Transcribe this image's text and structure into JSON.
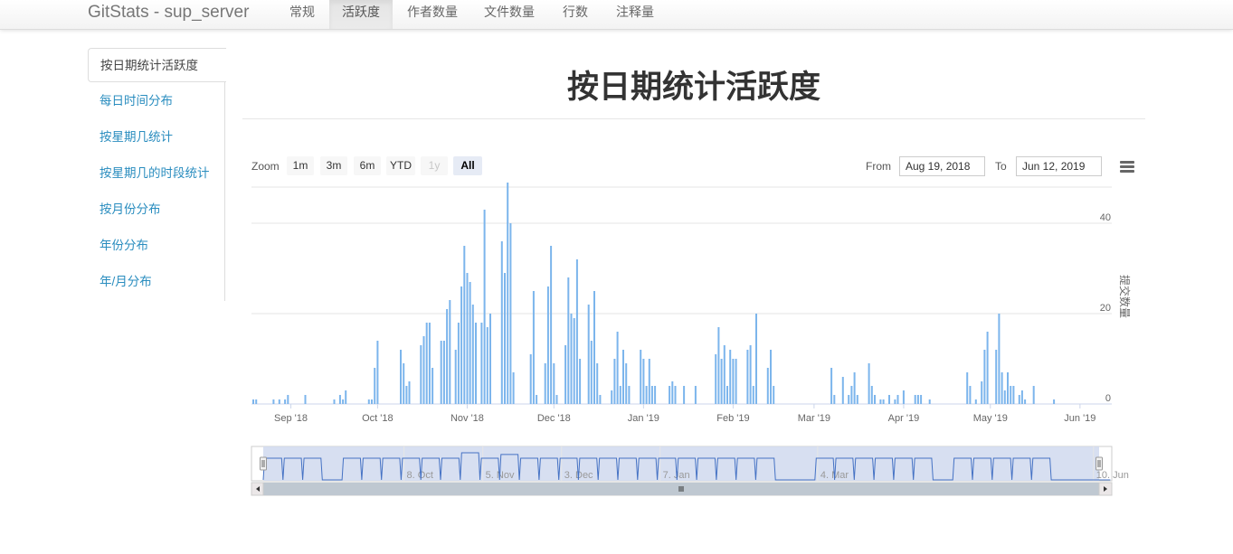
{
  "navbar": {
    "brand": "GitStats - sup_server",
    "items": [
      {
        "label": "常规",
        "active": false
      },
      {
        "label": "活跃度",
        "active": true
      },
      {
        "label": "作者数量",
        "active": false
      },
      {
        "label": "文件数量",
        "active": false
      },
      {
        "label": "行数",
        "active": false
      },
      {
        "label": "注释量",
        "active": false
      }
    ]
  },
  "sidebar": {
    "items": [
      {
        "label": "按日期统计活跃度",
        "active": true
      },
      {
        "label": "每日时间分布",
        "active": false
      },
      {
        "label": "按星期几统计",
        "active": false
      },
      {
        "label": "按星期几的时段统计",
        "active": false
      },
      {
        "label": "按月份分布",
        "active": false
      },
      {
        "label": "年份分布",
        "active": false
      },
      {
        "label": "年/月分布",
        "active": false
      }
    ]
  },
  "page": {
    "title": "按日期统计活跃度"
  },
  "range_selector": {
    "zoom_label": "Zoom",
    "buttons": [
      {
        "label": "1m",
        "state": "normal"
      },
      {
        "label": "3m",
        "state": "normal"
      },
      {
        "label": "6m",
        "state": "normal"
      },
      {
        "label": "YTD",
        "state": "normal"
      },
      {
        "label": "1y",
        "state": "disabled"
      },
      {
        "label": "All",
        "state": "selected"
      }
    ],
    "from_label": "From",
    "from_value": "Aug 19, 2018",
    "to_label": "To",
    "to_value": "Jun 12, 2019"
  },
  "colors": {
    "bar": "#7cb5ec",
    "navigator_line": "#4572c4",
    "navigator_fill": "#d3dcef",
    "link": "#2a8dbf"
  },
  "chart_data": {
    "type": "bar",
    "ylabel": "提交数量",
    "ylim": [
      0,
      48
    ],
    "yticks": [
      0,
      20,
      40
    ],
    "xlim": [
      "2018-08-19",
      "2019-06-12"
    ],
    "xticks": [
      {
        "label": "Sep '18",
        "date": "2018-09-01"
      },
      {
        "label": "Oct '18",
        "date": "2018-10-01"
      },
      {
        "label": "Nov '18",
        "date": "2018-11-01"
      },
      {
        "label": "Dec '18",
        "date": "2018-12-01"
      },
      {
        "label": "Jan '19",
        "date": "2019-01-01"
      },
      {
        "label": "Feb '19",
        "date": "2019-02-01"
      },
      {
        "label": "Mar '19",
        "date": "2019-03-01"
      },
      {
        "label": "Apr '19",
        "date": "2019-04-01"
      },
      {
        "label": "May '19",
        "date": "2019-05-01"
      },
      {
        "label": "Jun '19",
        "date": "2019-06-01"
      }
    ],
    "navigator_ticks": [
      {
        "label": "8. Oct",
        "date": "2018-10-08"
      },
      {
        "label": "5. Nov",
        "date": "2018-11-05"
      },
      {
        "label": "3. Dec",
        "date": "2018-12-03"
      },
      {
        "label": "7. Jan",
        "date": "2019-01-07"
      },
      {
        "label": "4. Mar",
        "date": "2019-03-04"
      },
      {
        "label": "10. Jun",
        "date": "2019-06-10"
      }
    ],
    "points": [
      [
        "2018-08-19",
        1
      ],
      [
        "2018-08-20",
        1
      ],
      [
        "2018-08-26",
        1
      ],
      [
        "2018-08-28",
        1
      ],
      [
        "2018-08-30",
        1
      ],
      [
        "2018-08-31",
        2
      ],
      [
        "2018-09-06",
        2
      ],
      [
        "2018-09-16",
        1
      ],
      [
        "2018-09-18",
        2
      ],
      [
        "2018-09-19",
        1
      ],
      [
        "2018-09-20",
        3
      ],
      [
        "2018-09-28",
        1
      ],
      [
        "2018-09-29",
        1
      ],
      [
        "2018-09-30",
        8
      ],
      [
        "2018-10-01",
        14
      ],
      [
        "2018-10-09",
        12
      ],
      [
        "2018-10-10",
        9
      ],
      [
        "2018-10-11",
        4
      ],
      [
        "2018-10-12",
        5
      ],
      [
        "2018-10-16",
        13
      ],
      [
        "2018-10-17",
        15
      ],
      [
        "2018-10-18",
        18
      ],
      [
        "2018-10-19",
        18
      ],
      [
        "2018-10-20",
        8
      ],
      [
        "2018-10-23",
        14
      ],
      [
        "2018-10-24",
        14
      ],
      [
        "2018-10-25",
        21
      ],
      [
        "2018-10-26",
        23
      ],
      [
        "2018-10-28",
        12
      ],
      [
        "2018-10-29",
        18
      ],
      [
        "2018-10-30",
        26
      ],
      [
        "2018-10-31",
        35
      ],
      [
        "2018-11-01",
        29
      ],
      [
        "2018-11-02",
        27
      ],
      [
        "2018-11-03",
        22
      ],
      [
        "2018-11-04",
        18
      ],
      [
        "2018-11-06",
        18
      ],
      [
        "2018-11-07",
        43
      ],
      [
        "2018-11-08",
        17
      ],
      [
        "2018-11-09",
        20
      ],
      [
        "2018-11-13",
        36
      ],
      [
        "2018-11-14",
        29
      ],
      [
        "2018-11-15",
        49
      ],
      [
        "2018-11-16",
        40
      ],
      [
        "2018-11-17",
        7
      ],
      [
        "2018-11-23",
        11
      ],
      [
        "2018-11-24",
        25
      ],
      [
        "2018-11-25",
        2
      ],
      [
        "2018-11-28",
        9
      ],
      [
        "2018-11-29",
        26
      ],
      [
        "2018-11-30",
        35
      ],
      [
        "2018-12-01",
        9
      ],
      [
        "2018-12-02",
        2
      ],
      [
        "2018-12-05",
        13
      ],
      [
        "2018-12-06",
        28
      ],
      [
        "2018-12-07",
        20
      ],
      [
        "2018-12-08",
        19
      ],
      [
        "2018-12-09",
        32
      ],
      [
        "2018-12-10",
        10
      ],
      [
        "2018-12-13",
        22
      ],
      [
        "2018-12-14",
        14
      ],
      [
        "2018-12-15",
        25
      ],
      [
        "2018-12-16",
        9
      ],
      [
        "2018-12-17",
        2
      ],
      [
        "2018-12-21",
        3
      ],
      [
        "2018-12-22",
        10
      ],
      [
        "2018-12-23",
        16
      ],
      [
        "2018-12-24",
        4
      ],
      [
        "2018-12-25",
        12
      ],
      [
        "2018-12-26",
        9
      ],
      [
        "2018-12-27",
        4
      ],
      [
        "2018-12-31",
        12
      ],
      [
        "2019-01-01",
        10
      ],
      [
        "2019-01-02",
        4
      ],
      [
        "2019-01-03",
        10
      ],
      [
        "2019-01-04",
        4
      ],
      [
        "2019-01-05",
        4
      ],
      [
        "2019-01-10",
        4
      ],
      [
        "2019-01-11",
        5
      ],
      [
        "2019-01-12",
        4
      ],
      [
        "2019-01-15",
        4
      ],
      [
        "2019-01-19",
        4
      ],
      [
        "2019-01-26",
        11
      ],
      [
        "2019-01-27",
        17
      ],
      [
        "2019-01-28",
        10
      ],
      [
        "2019-01-29",
        13
      ],
      [
        "2019-01-30",
        4
      ],
      [
        "2019-01-31",
        12
      ],
      [
        "2019-02-01",
        10
      ],
      [
        "2019-02-02",
        10
      ],
      [
        "2019-02-06",
        12
      ],
      [
        "2019-02-07",
        13
      ],
      [
        "2019-02-08",
        4
      ],
      [
        "2019-02-09",
        20
      ],
      [
        "2019-02-13",
        8
      ],
      [
        "2019-02-14",
        12
      ],
      [
        "2019-02-15",
        4
      ],
      [
        "2019-03-07",
        8
      ],
      [
        "2019-03-08",
        2
      ],
      [
        "2019-03-11",
        6
      ],
      [
        "2019-03-13",
        2
      ],
      [
        "2019-03-14",
        4
      ],
      [
        "2019-03-15",
        7
      ],
      [
        "2019-03-16",
        2
      ],
      [
        "2019-03-20",
        9
      ],
      [
        "2019-03-21",
        4
      ],
      [
        "2019-03-22",
        2
      ],
      [
        "2019-03-24",
        1
      ],
      [
        "2019-03-25",
        1
      ],
      [
        "2019-03-27",
        2
      ],
      [
        "2019-03-29",
        1
      ],
      [
        "2019-03-30",
        2
      ],
      [
        "2019-04-01",
        3
      ],
      [
        "2019-04-05",
        2
      ],
      [
        "2019-04-06",
        2
      ],
      [
        "2019-04-07",
        2
      ],
      [
        "2019-04-10",
        1
      ],
      [
        "2019-04-23",
        7
      ],
      [
        "2019-04-24",
        4
      ],
      [
        "2019-04-26",
        1
      ],
      [
        "2019-04-28",
        5
      ],
      [
        "2019-04-29",
        12
      ],
      [
        "2019-04-30",
        16
      ],
      [
        "2019-05-03",
        12
      ],
      [
        "2019-05-04",
        20
      ],
      [
        "2019-05-05",
        7
      ],
      [
        "2019-05-06",
        3
      ],
      [
        "2019-05-07",
        7
      ],
      [
        "2019-05-08",
        4
      ],
      [
        "2019-05-09",
        4
      ],
      [
        "2019-05-11",
        2
      ],
      [
        "2019-05-12",
        3
      ],
      [
        "2019-05-13",
        1
      ],
      [
        "2019-05-16",
        4
      ],
      [
        "2019-05-23",
        1
      ]
    ]
  }
}
